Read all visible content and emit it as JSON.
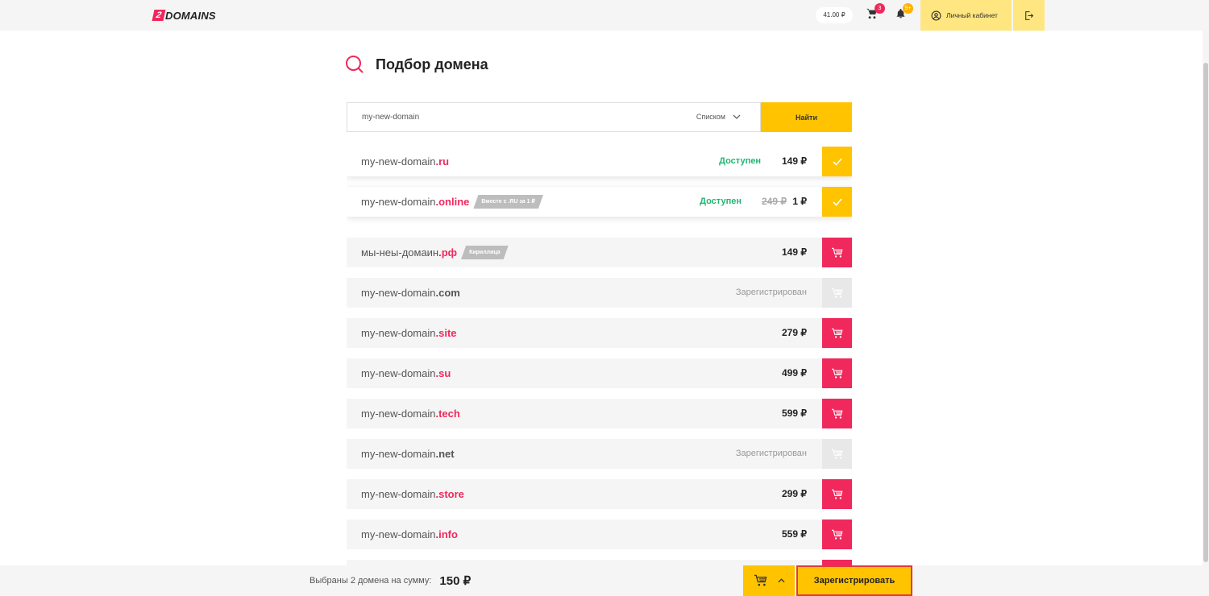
{
  "header": {
    "logo_mark": "2",
    "logo_text": "DOMAINS",
    "balance": "41.00 ₽",
    "cart_count": "3",
    "notif_count": "9+",
    "cabinet_label": "Личный кабинет"
  },
  "page": {
    "title": "Подбор домена"
  },
  "search": {
    "value": "my-new-domain",
    "view_mode": "Списком",
    "find_label": "Найти"
  },
  "domains": [
    {
      "name": "my-new-domain",
      "zone": ".ru",
      "tag": "",
      "status": "Доступен",
      "old_price": "",
      "price": "149 ₽",
      "action": "selected"
    },
    {
      "name": "my-new-domain",
      "zone": ".online",
      "tag": "Вместе с .RU за 1 ₽",
      "status": "Доступен",
      "old_price": "249 ₽",
      "price": "1 ₽",
      "action": "selected"
    },
    {
      "name": "мы-неы-домаин",
      "zone": ".рф",
      "tag": "Кириллица",
      "status": "",
      "old_price": "",
      "price": "149 ₽",
      "action": "cart"
    },
    {
      "name": "my-new-domain",
      "zone": ".com",
      "tag": "",
      "status": "Зарегистрирован",
      "old_price": "",
      "price": "",
      "action": "disabled"
    },
    {
      "name": "my-new-domain",
      "zone": ".site",
      "tag": "",
      "status": "",
      "old_price": "",
      "price": "279 ₽",
      "action": "cart"
    },
    {
      "name": "my-new-domain",
      "zone": ".su",
      "tag": "",
      "status": "",
      "old_price": "",
      "price": "499 ₽",
      "action": "cart"
    },
    {
      "name": "my-new-domain",
      "zone": ".tech",
      "tag": "",
      "status": "",
      "old_price": "",
      "price": "599 ₽",
      "action": "cart"
    },
    {
      "name": "my-new-domain",
      "zone": ".net",
      "tag": "",
      "status": "Зарегистрирован",
      "old_price": "",
      "price": "",
      "action": "disabled"
    },
    {
      "name": "my-new-domain",
      "zone": ".store",
      "tag": "",
      "status": "",
      "old_price": "",
      "price": "299 ₽",
      "action": "cart"
    },
    {
      "name": "my-new-domain",
      "zone": ".info",
      "tag": "",
      "status": "",
      "old_price": "",
      "price": "559 ₽",
      "action": "cart"
    },
    {
      "name": "",
      "zone": "",
      "tag": "",
      "status": "",
      "old_price": "",
      "price": "",
      "action": "cart"
    }
  ],
  "footer": {
    "summary_label": "Выбраны 2 домена на сумму:",
    "summary_total": "150 ₽",
    "register_label": "Зарегистрировать"
  },
  "colors": {
    "accent_yellow": "#ffc300",
    "accent_pink": "#f0285c",
    "available_green": "#22b573",
    "muted_bg": "#f5f5f5"
  }
}
